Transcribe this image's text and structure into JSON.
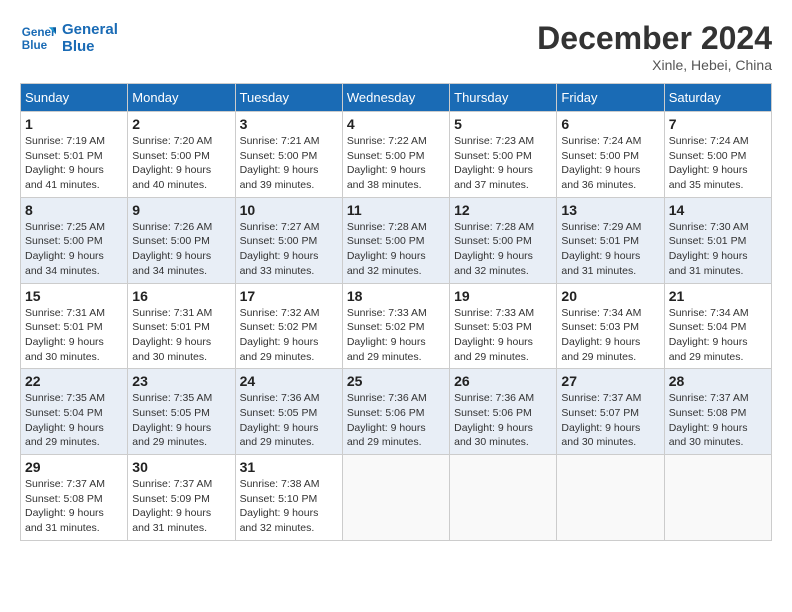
{
  "logo": {
    "line1": "General",
    "line2": "Blue"
  },
  "title": "December 2024",
  "location": "Xinle, Hebei, China",
  "weekdays": [
    "Sunday",
    "Monday",
    "Tuesday",
    "Wednesday",
    "Thursday",
    "Friday",
    "Saturday"
  ],
  "weeks": [
    [
      {
        "day": "1",
        "info": "Sunrise: 7:19 AM\nSunset: 5:01 PM\nDaylight: 9 hours\nand 41 minutes."
      },
      {
        "day": "2",
        "info": "Sunrise: 7:20 AM\nSunset: 5:00 PM\nDaylight: 9 hours\nand 40 minutes."
      },
      {
        "day": "3",
        "info": "Sunrise: 7:21 AM\nSunset: 5:00 PM\nDaylight: 9 hours\nand 39 minutes."
      },
      {
        "day": "4",
        "info": "Sunrise: 7:22 AM\nSunset: 5:00 PM\nDaylight: 9 hours\nand 38 minutes."
      },
      {
        "day": "5",
        "info": "Sunrise: 7:23 AM\nSunset: 5:00 PM\nDaylight: 9 hours\nand 37 minutes."
      },
      {
        "day": "6",
        "info": "Sunrise: 7:24 AM\nSunset: 5:00 PM\nDaylight: 9 hours\nand 36 minutes."
      },
      {
        "day": "7",
        "info": "Sunrise: 7:24 AM\nSunset: 5:00 PM\nDaylight: 9 hours\nand 35 minutes."
      }
    ],
    [
      {
        "day": "8",
        "info": "Sunrise: 7:25 AM\nSunset: 5:00 PM\nDaylight: 9 hours\nand 34 minutes."
      },
      {
        "day": "9",
        "info": "Sunrise: 7:26 AM\nSunset: 5:00 PM\nDaylight: 9 hours\nand 34 minutes."
      },
      {
        "day": "10",
        "info": "Sunrise: 7:27 AM\nSunset: 5:00 PM\nDaylight: 9 hours\nand 33 minutes."
      },
      {
        "day": "11",
        "info": "Sunrise: 7:28 AM\nSunset: 5:00 PM\nDaylight: 9 hours\nand 32 minutes."
      },
      {
        "day": "12",
        "info": "Sunrise: 7:28 AM\nSunset: 5:00 PM\nDaylight: 9 hours\nand 32 minutes."
      },
      {
        "day": "13",
        "info": "Sunrise: 7:29 AM\nSunset: 5:01 PM\nDaylight: 9 hours\nand 31 minutes."
      },
      {
        "day": "14",
        "info": "Sunrise: 7:30 AM\nSunset: 5:01 PM\nDaylight: 9 hours\nand 31 minutes."
      }
    ],
    [
      {
        "day": "15",
        "info": "Sunrise: 7:31 AM\nSunset: 5:01 PM\nDaylight: 9 hours\nand 30 minutes."
      },
      {
        "day": "16",
        "info": "Sunrise: 7:31 AM\nSunset: 5:01 PM\nDaylight: 9 hours\nand 30 minutes."
      },
      {
        "day": "17",
        "info": "Sunrise: 7:32 AM\nSunset: 5:02 PM\nDaylight: 9 hours\nand 29 minutes."
      },
      {
        "day": "18",
        "info": "Sunrise: 7:33 AM\nSunset: 5:02 PM\nDaylight: 9 hours\nand 29 minutes."
      },
      {
        "day": "19",
        "info": "Sunrise: 7:33 AM\nSunset: 5:03 PM\nDaylight: 9 hours\nand 29 minutes."
      },
      {
        "day": "20",
        "info": "Sunrise: 7:34 AM\nSunset: 5:03 PM\nDaylight: 9 hours\nand 29 minutes."
      },
      {
        "day": "21",
        "info": "Sunrise: 7:34 AM\nSunset: 5:04 PM\nDaylight: 9 hours\nand 29 minutes."
      }
    ],
    [
      {
        "day": "22",
        "info": "Sunrise: 7:35 AM\nSunset: 5:04 PM\nDaylight: 9 hours\nand 29 minutes."
      },
      {
        "day": "23",
        "info": "Sunrise: 7:35 AM\nSunset: 5:05 PM\nDaylight: 9 hours\nand 29 minutes."
      },
      {
        "day": "24",
        "info": "Sunrise: 7:36 AM\nSunset: 5:05 PM\nDaylight: 9 hours\nand 29 minutes."
      },
      {
        "day": "25",
        "info": "Sunrise: 7:36 AM\nSunset: 5:06 PM\nDaylight: 9 hours\nand 29 minutes."
      },
      {
        "day": "26",
        "info": "Sunrise: 7:36 AM\nSunset: 5:06 PM\nDaylight: 9 hours\nand 30 minutes."
      },
      {
        "day": "27",
        "info": "Sunrise: 7:37 AM\nSunset: 5:07 PM\nDaylight: 9 hours\nand 30 minutes."
      },
      {
        "day": "28",
        "info": "Sunrise: 7:37 AM\nSunset: 5:08 PM\nDaylight: 9 hours\nand 30 minutes."
      }
    ],
    [
      {
        "day": "29",
        "info": "Sunrise: 7:37 AM\nSunset: 5:08 PM\nDaylight: 9 hours\nand 31 minutes."
      },
      {
        "day": "30",
        "info": "Sunrise: 7:37 AM\nSunset: 5:09 PM\nDaylight: 9 hours\nand 31 minutes."
      },
      {
        "day": "31",
        "info": "Sunrise: 7:38 AM\nSunset: 5:10 PM\nDaylight: 9 hours\nand 32 minutes."
      },
      {
        "day": "",
        "info": ""
      },
      {
        "day": "",
        "info": ""
      },
      {
        "day": "",
        "info": ""
      },
      {
        "day": "",
        "info": ""
      }
    ]
  ]
}
